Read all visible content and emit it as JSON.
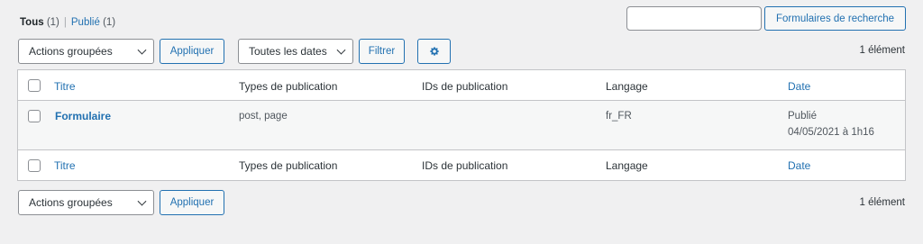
{
  "filters": {
    "all_label": "Tous",
    "all_count": "(1)",
    "separator": "|",
    "published_label": "Publié",
    "published_count": "(1)"
  },
  "search": {
    "value": "",
    "button_label": "Formulaires de recherche"
  },
  "top_nav": {
    "bulk_actions": "Actions groupées",
    "apply_label": "Appliquer",
    "dates_select": "Toutes les dates",
    "filter_label": "Filtrer",
    "gear_icon": "gear-icon",
    "item_count": "1 élément"
  },
  "table": {
    "columns": [
      "Titre",
      "Types de publication",
      "IDs de publication",
      "Langage",
      "Date"
    ],
    "rows": [
      {
        "title": "Formulaire",
        "post_types": "post, page",
        "post_ids": "",
        "language": "fr_FR",
        "status": "Publié",
        "date": "04/05/2021 à 1h16"
      }
    ]
  },
  "bottom_nav": {
    "bulk_actions": "Actions groupées",
    "apply_label": "Appliquer",
    "item_count": "1 élément"
  },
  "colors": {
    "link": "#2271b1",
    "background": "#f0f0f1",
    "border": "#c3c4c7"
  }
}
